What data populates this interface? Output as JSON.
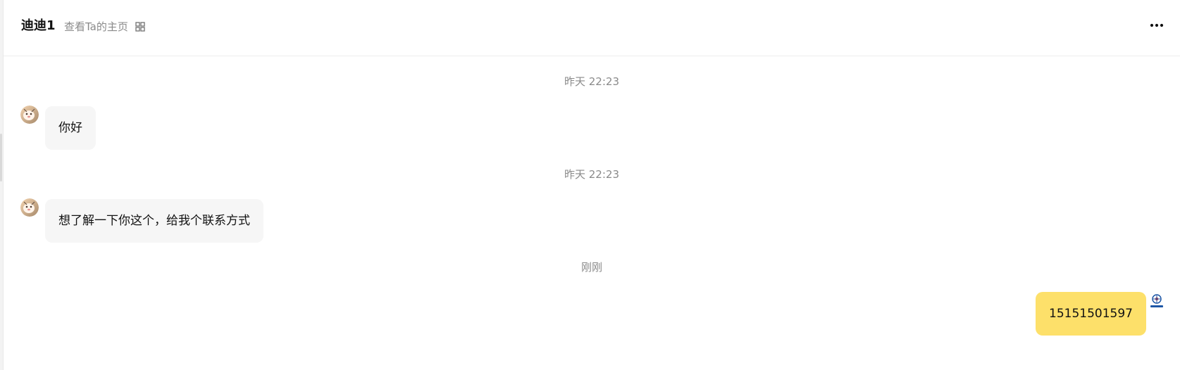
{
  "header": {
    "name": "迪迪1",
    "profile_link": "查看Ta的主页",
    "qr_icon": "qr-code-icon",
    "more_icon": "more-horizontal-icon"
  },
  "messages": [
    {
      "time": "昨天 22:23",
      "sender": "other",
      "text": "你好",
      "avatar": "cat-avatar-icon"
    },
    {
      "time": "昨天 22:23",
      "sender": "other",
      "text": "想了解一下你这个，给我个联系方式",
      "avatar": "cat-avatar-icon"
    },
    {
      "time": "刚刚",
      "sender": "self",
      "text": "15151501597",
      "avatar": "logo-avatar-icon"
    }
  ],
  "colors": {
    "incoming_bubble": "#f6f6f6",
    "outgoing_bubble": "#fde06a",
    "muted_text": "#8a8a8a"
  }
}
